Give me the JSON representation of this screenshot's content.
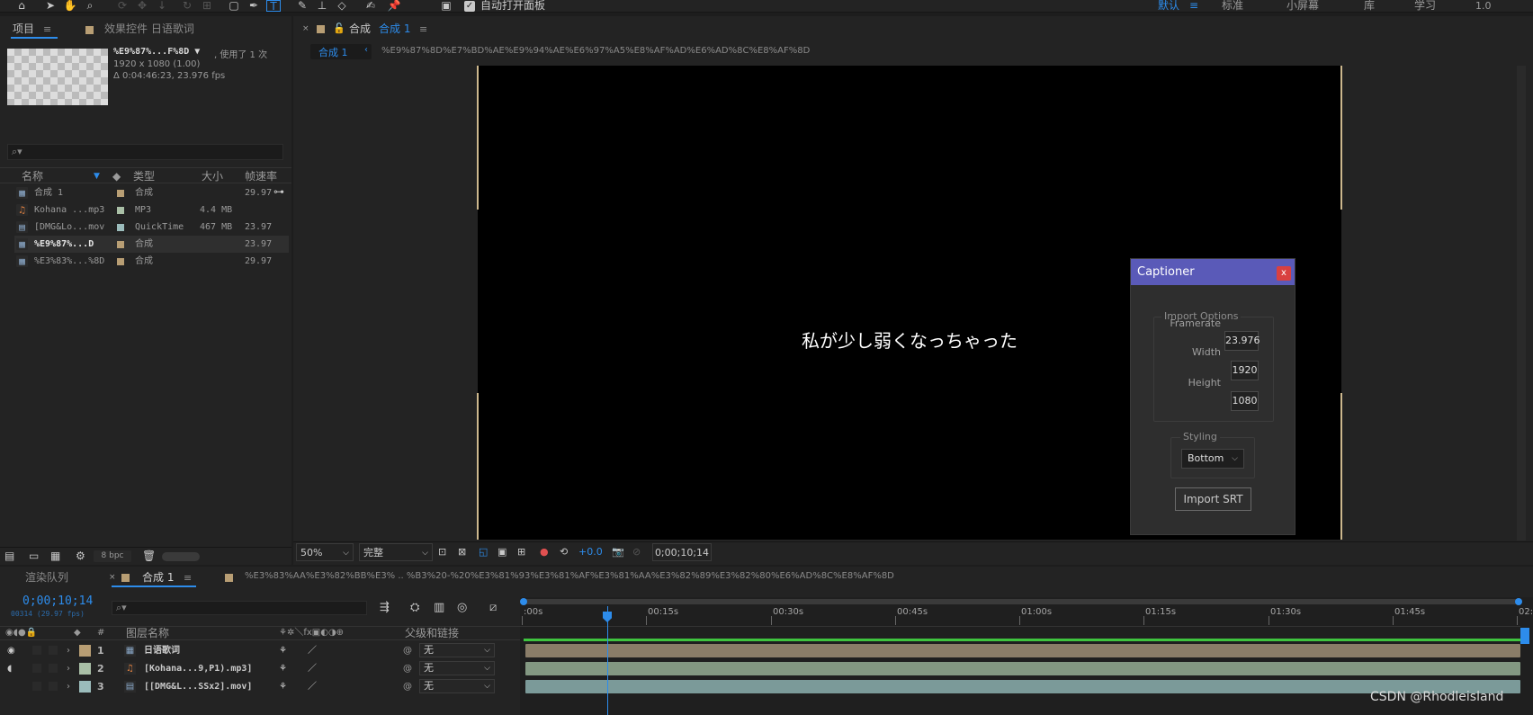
{
  "toolbar": {
    "autoopen_label": "自动打开面板",
    "workspaces": [
      "默认",
      "标准",
      "小屏幕",
      "库",
      "学习"
    ],
    "workspace_active": "默认",
    "version_label": "1.0"
  },
  "project": {
    "tab_label": "项目",
    "effects_tab_label": "效果控件 日语歌词",
    "preview_name": "%E9%87%...F%8D ▼",
    "used_label": ", 使用了 1 次",
    "preview_res": "1920 x 1080 (1.00)",
    "preview_dur": "Δ 0:04:46:23, 23.976 fps",
    "search_placeholder": "⌕▾",
    "columns": {
      "name": "名称",
      "type": "类型",
      "size": "大小",
      "fps": "帧速率"
    },
    "items": [
      {
        "name": "合成 1",
        "type": "合成",
        "size": "",
        "fps": "29.97",
        "color": "#b89e74",
        "icon": "composition-icon"
      },
      {
        "name": "Kohana ...mp3",
        "type": "MP3",
        "size": "4.4 MB",
        "fps": "",
        "color": "#a9bfa6",
        "icon": "audio-file-icon"
      },
      {
        "name": "[DMG&Lo...mov",
        "type": "QuickTime",
        "size": "467 MB",
        "fps": "23.976",
        "color": "#9bbcbb",
        "icon": "video-file-icon"
      },
      {
        "name": "%E9%87%...D",
        "type": "合成",
        "size": "",
        "fps": "23.976",
        "color": "#b89e74",
        "icon": "composition-icon"
      },
      {
        "name": "%E3%83%...%8D",
        "type": "合成",
        "size": "",
        "fps": "29.97",
        "color": "#b89e74",
        "icon": "composition-icon"
      }
    ],
    "bpc_label": "8 bpc"
  },
  "viewer": {
    "tab_prefix": "合成",
    "tab_name": "合成 1",
    "breadcrumb_active": "合成 1",
    "breadcrumb_path": "%E9%87%8D%E7%BD%AE%E9%94%AE%E6%97%A5%E8%AF%AD%E6%AD%8C%E8%AF%8D",
    "subtitle_text": "私が少し弱くなっちゃった",
    "zoom": "50%",
    "quality": "完整",
    "exposure": "+0.0",
    "timecode": "0;00;10;14"
  },
  "captioner": {
    "title": "Captioner",
    "close": "x",
    "import_options_legend": "Import Options",
    "fields": [
      {
        "label": "Framerate",
        "value": "23.976"
      },
      {
        "label": "Width",
        "value": "1920"
      },
      {
        "label": "Height",
        "value": "1080"
      }
    ],
    "styling_legend": "Styling",
    "styling_value": "Bottom",
    "import_button": "Import SRT"
  },
  "timeline": {
    "render_queue_tab": "渲染队列",
    "comp_tab": "合成 1",
    "other_tab": "%E3%83%AA%E3%82%BB%E3% .. %B3%20-%20%E3%81%93%E3%81%AF%E3%81%AA%E3%82%89%E3%82%80%E6%AD%8C%E8%AF%8D",
    "timecode": "0;00;10;14",
    "frame_info": "00314 (29.97 fps)",
    "col_layer_name": "图层名称",
    "col_parent": "父级和链接",
    "layers": [
      {
        "num": "1",
        "name": "日语歌词",
        "parent": "无",
        "color": "#b89e74",
        "bar_color": "#8a7d68",
        "icon": "text-layer-icon"
      },
      {
        "num": "2",
        "name": "[Kohana...9,P1).mp3]",
        "parent": "无",
        "color": "#a9bfa6",
        "bar_color": "#839882",
        "icon": "audio-layer-icon"
      },
      {
        "num": "3",
        "name": "[[DMG&L...SSx2].mov]",
        "parent": "无",
        "color": "#9bbcbb",
        "bar_color": "#7b9a99",
        "icon": "video-layer-icon"
      }
    ],
    "ruler_ticks": [
      ":00s",
      "00:15s",
      "00:30s",
      "00:45s",
      "01:00s",
      "01:15s",
      "01:30s",
      "01:45s",
      "02:0"
    ],
    "playhead_fraction": 0.087
  },
  "watermark": "CSDN @Rhodleisland"
}
